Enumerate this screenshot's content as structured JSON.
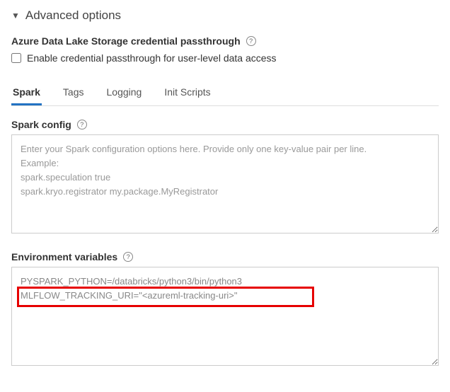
{
  "section": {
    "title": "Advanced options"
  },
  "adls": {
    "heading": "Azure Data Lake Storage credential passthrough",
    "checkbox_label": "Enable credential passthrough for user-level data access"
  },
  "tabs": {
    "items": [
      {
        "label": "Spark",
        "active": true
      },
      {
        "label": "Tags",
        "active": false
      },
      {
        "label": "Logging",
        "active": false
      },
      {
        "label": "Init Scripts",
        "active": false
      }
    ]
  },
  "spark_config": {
    "label": "Spark config",
    "placeholder": "Enter your Spark configuration options here. Provide only one key-value pair per line.\nExample:\nspark.speculation true\nspark.kryo.registrator my.package.MyRegistrator",
    "value": ""
  },
  "env_vars": {
    "label": "Environment variables",
    "value": "PYSPARK_PYTHON=/databricks/python3/bin/python3\nMLFLOW_TRACKING_URI=\"<azureml-tracking-uri>\""
  },
  "help_glyph": "?"
}
